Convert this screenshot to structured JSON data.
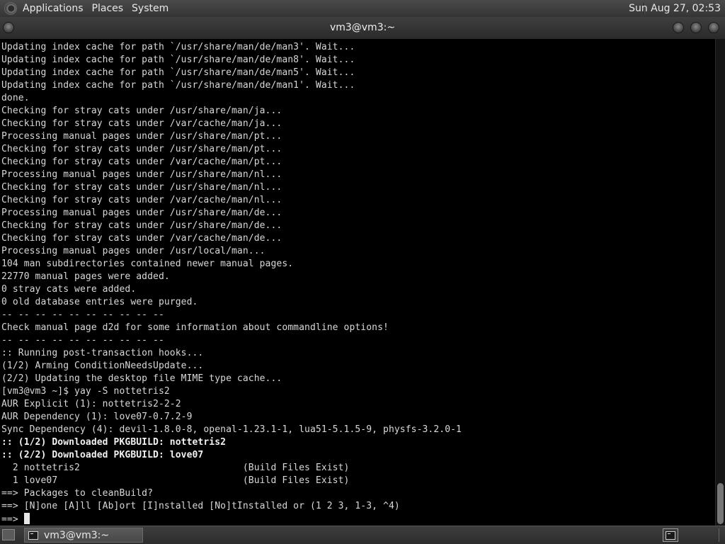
{
  "top_panel": {
    "menus": [
      "Applications",
      "Places",
      "System"
    ],
    "clock": "Sun Aug 27, 02:53"
  },
  "window": {
    "title": "vm3@vm3:~"
  },
  "terminal": {
    "lines": [
      {
        "text": "Updating index cache for path `/usr/share/man/de/man3'. Wait..."
      },
      {
        "text": "Updating index cache for path `/usr/share/man/de/man8'. Wait..."
      },
      {
        "text": "Updating index cache for path `/usr/share/man/de/man5'. Wait..."
      },
      {
        "text": "Updating index cache for path `/usr/share/man/de/man1'. Wait..."
      },
      {
        "text": "done."
      },
      {
        "text": "Checking for stray cats under /usr/share/man/ja..."
      },
      {
        "text": "Checking for stray cats under /var/cache/man/ja..."
      },
      {
        "text": "Processing manual pages under /usr/share/man/pt..."
      },
      {
        "text": "Checking for stray cats under /usr/share/man/pt..."
      },
      {
        "text": "Checking for stray cats under /var/cache/man/pt..."
      },
      {
        "text": "Processing manual pages under /usr/share/man/nl..."
      },
      {
        "text": "Checking for stray cats under /usr/share/man/nl..."
      },
      {
        "text": "Checking for stray cats under /var/cache/man/nl..."
      },
      {
        "text": "Processing manual pages under /usr/share/man/de..."
      },
      {
        "text": "Checking for stray cats under /usr/share/man/de..."
      },
      {
        "text": "Checking for stray cats under /var/cache/man/de..."
      },
      {
        "text": "Processing manual pages under /usr/local/man..."
      },
      {
        "text": "104 man subdirectories contained newer manual pages."
      },
      {
        "text": "22770 manual pages were added."
      },
      {
        "text": "0 stray cats were added."
      },
      {
        "text": "0 old database entries were purged."
      },
      {
        "text": "-- -- -- -- -- -- -- -- -- --"
      },
      {
        "text": "Check manual page d2d for some information about commandline options!"
      },
      {
        "text": "-- -- -- -- -- -- -- -- -- --"
      },
      {
        "text": ":: Running post-transaction hooks..."
      },
      {
        "text": "(1/2) Arming ConditionNeedsUpdate..."
      },
      {
        "text": "(2/2) Updating the desktop file MIME type cache..."
      },
      {
        "text": "[vm3@vm3 ~]$ yay -S nottetris2"
      },
      {
        "text": "AUR Explicit (1): nottetris2-2-2"
      },
      {
        "text": "AUR Dependency (1): love07-0.7.2-9"
      },
      {
        "text": "Sync Dependency (4): devil-1.8.0-8, openal-1.23.1-1, lua51-5.1.5-9, physfs-3.2.0-1"
      },
      {
        "text": ":: (1/2) Downloaded PKGBUILD: nottetris2",
        "bold": true
      },
      {
        "text": ":: (2/2) Downloaded PKGBUILD: love07",
        "bold": true
      },
      {
        "text": "  2 nottetris2                             (Build Files Exist)"
      },
      {
        "text": "  1 love07                                 (Build Files Exist)"
      },
      {
        "text": "==> Packages to cleanBuild?"
      },
      {
        "text": "==> [N]one [A]ll [Ab]ort [I]nstalled [No]tInstalled or (1 2 3, 1-3, ^4)"
      }
    ],
    "prompt": "==> "
  },
  "bottom_panel": {
    "taskbar_item": "vm3@vm3:~"
  },
  "icons": {
    "distro": "distro-logo-icon",
    "show_desktop": "show-desktop-icon",
    "terminal": "terminal-icon"
  },
  "colors": {
    "terminal_bg": "#000000",
    "terminal_fg": "#d8d8d8",
    "panel_bg": "#3a3a3a"
  }
}
